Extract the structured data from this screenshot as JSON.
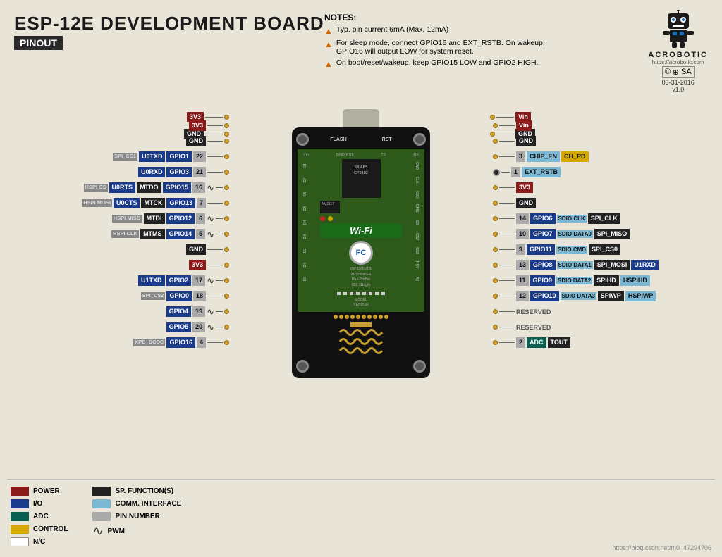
{
  "page": {
    "title": "ESP-12E DEVELOPMENT BOARD",
    "subtitle": "PINOUT",
    "background": "#e8e8e0"
  },
  "header": {
    "title": "ESP-12E DEVELOPMENT BOARD",
    "subtitle": "PINOUT"
  },
  "notes": {
    "title": "NOTES:",
    "items": [
      "Typ. pin current 6mA (Max. 12mA)",
      "For sleep mode, connect GPIO16 and EXT_RSTB. On wakeup, GPIO16 will output LOW for system reset.",
      "On boot/reset/wakeup, keep GPIO15 LOW and GPIO2 HIGH."
    ]
  },
  "logo": {
    "url": "https://acrobotic.com",
    "cc": "CC BY SA",
    "date": "03-31-2016",
    "version": "v1.0"
  },
  "legend": {
    "items": [
      {
        "label": "POWER",
        "color": "#8b1a1a"
      },
      {
        "label": "I/O",
        "color": "#1a3a8a"
      },
      {
        "label": "ADC",
        "color": "#0a6050"
      },
      {
        "label": "CONTROL",
        "color": "#d4a800"
      },
      {
        "label": "N/C",
        "color": "#ffffff"
      },
      {
        "label": "SP. FUNCTION(S)",
        "color": "#222222"
      },
      {
        "label": "COMM. INTERFACE",
        "color": "#7ab8d4"
      },
      {
        "label": "PIN NUMBER",
        "color": "#aaaaaa"
      },
      {
        "label": "PWM",
        "color": "wave"
      }
    ]
  },
  "left_pins": [
    {
      "extra": "",
      "func": "SPI_CS1",
      "name": "U0TXD",
      "gpio": "GPIO1",
      "num": "22",
      "pwm": false
    },
    {
      "extra": "",
      "func": "",
      "name": "U0RXD",
      "gpio": "GPIO3",
      "num": "21",
      "pwm": false
    },
    {
      "extra": "HSPI CS",
      "func": "U0RTS",
      "name": "MTDO",
      "gpio": "GPIO15",
      "num": "16",
      "pwm": true
    },
    {
      "extra": "HSPI MOSI",
      "func": "U0CTS",
      "name": "MTCK",
      "gpio": "GPIO13",
      "num": "7",
      "pwm": false
    },
    {
      "extra": "HSPI MISO",
      "func": "",
      "name": "MTDI",
      "gpio": "GPIO12",
      "num": "6",
      "pwm": true
    },
    {
      "extra": "HSPI CLK",
      "func": "",
      "name": "MTMS",
      "gpio": "GPIO14",
      "num": "5",
      "pwm": true
    },
    {
      "extra": "",
      "func": "",
      "name": "GND",
      "gpio": "",
      "num": "",
      "pwm": false
    },
    {
      "extra": "",
      "func": "",
      "name": "3V3",
      "gpio": "",
      "num": "",
      "pwm": false
    },
    {
      "extra": "",
      "func": "U1TXD",
      "name": "GPIO2",
      "gpio": "GPIO2",
      "num": "17",
      "pwm": true
    },
    {
      "extra": "",
      "func": "SPI_CS2",
      "name": "GPIO0",
      "gpio": "GPIO0",
      "num": "18",
      "pwm": false
    },
    {
      "extra": "",
      "func": "",
      "name": "GPIO4",
      "gpio": "GPIO4",
      "num": "19",
      "pwm": true
    },
    {
      "extra": "",
      "func": "",
      "name": "GPIO5",
      "gpio": "GPIO5",
      "num": "20",
      "pwm": true
    },
    {
      "extra": "XPD_DCDC",
      "func": "",
      "name": "GPIO16",
      "gpio": "GPIO16",
      "num": "4",
      "pwm": false
    }
  ],
  "right_pins": [
    {
      "num": "",
      "gpio": "Vin",
      "func": "",
      "extra": "",
      "extra2": ""
    },
    {
      "num": "",
      "gpio": "GND",
      "func": "",
      "extra": "",
      "extra2": ""
    },
    {
      "num": "3",
      "gpio": "CH_PD",
      "func": "CHIP_EN",
      "extra": "",
      "extra2": ""
    },
    {
      "num": "1",
      "gpio": "",
      "func": "EXT_RSTB",
      "extra": "",
      "extra2": ""
    },
    {
      "num": "",
      "gpio": "3V3",
      "func": "",
      "extra": "",
      "extra2": ""
    },
    {
      "num": "",
      "gpio": "GND",
      "func": "",
      "extra": "",
      "extra2": ""
    },
    {
      "num": "14",
      "gpio": "GPIO6",
      "func": "",
      "extra": "SDIO CLK",
      "extra2": "SPI_CLK"
    },
    {
      "num": "10",
      "gpio": "GPIO7",
      "func": "",
      "extra": "SDIO DATA0",
      "extra2": "SPI_MISO"
    },
    {
      "num": "9",
      "gpio": "GPIO11",
      "func": "",
      "extra": "SDIO CMD",
      "extra2": "SPI_CS0"
    },
    {
      "num": "13",
      "gpio": "GPIO8",
      "func": "",
      "extra": "SDIO DATA1",
      "extra2": "SPI_MOSI U1RXD"
    },
    {
      "num": "11",
      "gpio": "GPIO9",
      "func": "",
      "extra": "SDIO DATA2",
      "extra2": "SPIHD HSPIHD"
    },
    {
      "num": "12",
      "gpio": "GPIO10",
      "func": "",
      "extra": "SDIO DATA3",
      "extra2": "SPIWP HSPIWP"
    },
    {
      "num": "",
      "gpio": "RESERVED",
      "func": "",
      "extra": "",
      "extra2": ""
    },
    {
      "num": "",
      "gpio": "RESERVED",
      "func": "",
      "extra": "",
      "extra2": ""
    },
    {
      "num": "2",
      "gpio": "ADC",
      "func": "",
      "extra": "TOUT",
      "extra2": ""
    }
  ],
  "footer": {
    "url": "https://blog.csdn.net/m0_47294706"
  }
}
